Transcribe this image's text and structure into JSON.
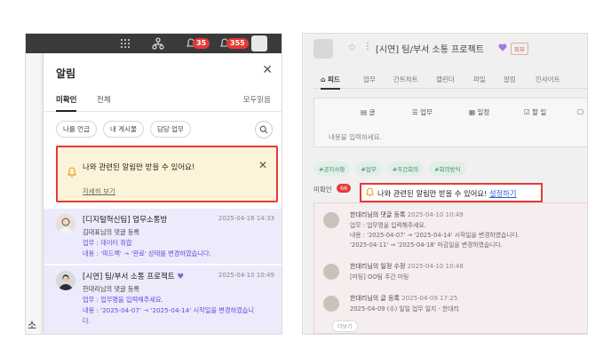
{
  "topbar": {
    "badge1": "35",
    "badge2": "355",
    "grid_icon": "grid-icon",
    "org_icon": "org-chart-icon",
    "bell_icon": "bell-icon"
  },
  "background_text": "소리",
  "drawer": {
    "title": "알림",
    "tabs": [
      "미확인",
      "전체"
    ],
    "mark_all": "모두읽음",
    "chips": [
      "나를 언급",
      "내 게시물",
      "담당 업무"
    ],
    "notice": {
      "text": "나와 관련된 알림만 받을 수 있어요!",
      "link": "자세히 보기"
    },
    "items": [
      {
        "title": "[디지털혁신팀] 업무소통방",
        "date": "2025-04-16 14:33",
        "lines": [
          "김대표님의 댓글 등록",
          "업무 : 데이터 취합",
          "내용 : '피드백' → '완료' 상태를 변경하였습니다."
        ]
      },
      {
        "title": "[시연] 팀/부서 소통 프로젝트",
        "date": "2025-04-10 10:49",
        "lines": [
          "한대리님의 댓글 등록",
          "업무 : 업무명을 입력해주세요.",
          "내용 : '2025-04-07' → '2025-04-14' 시작일을 변경하였습니",
          "다."
        ]
      }
    ]
  },
  "right": {
    "title": "[시연] 팀/부서 소통 프로젝트",
    "ext_label": "외부",
    "tabs": [
      "피드",
      "업무",
      "간트차트",
      "캘린더",
      "파일",
      "알림",
      "인사이트"
    ],
    "composer_items": [
      "글",
      "업무",
      "일정",
      "할 일"
    ],
    "composer_placeholder": "내용을 입력하세요.",
    "tags": [
      "#공지사항",
      "#업무",
      "#주간회의",
      "#회의방식"
    ],
    "unread_label": "미확인",
    "unread_count": "66",
    "notice_text": "나와 관련된 알림만 받을 수 있어요!",
    "notice_link": "설정하기",
    "feed": [
      {
        "title": "한대리님의 댓글 등록",
        "date": "2025-04-10 10:49",
        "lines": [
          "업무 : 업무명을 입력해주세요.",
          "내용 : '2025-04-07' → '2025-04-14' 시작일을 변경하였습니다.",
          "'2025-04-11' → '2025-04-18' 마감일을 변경하였습니다."
        ]
      },
      {
        "title": "한대리님의 일정 수정",
        "date": "2025-04-10 10:48",
        "lines": [
          "[미팅] OO팀 주간 미팅"
        ]
      },
      {
        "title": "한대리님의 글 등록",
        "date": "2025-04-09 17:25",
        "lines": [
          "2025-04-09 (수) 일일 업무 일지 - 한대리"
        ]
      }
    ],
    "more_label": "더보기"
  }
}
